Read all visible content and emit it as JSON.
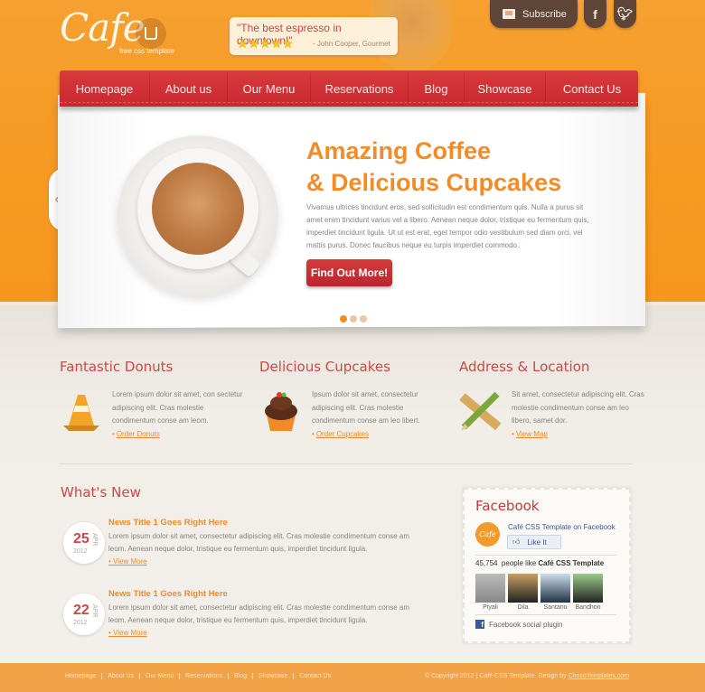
{
  "header": {
    "logo_text": "Cafe",
    "logo_tagline": "free css template",
    "quote": "\"The best espresso in downtown!\"",
    "rating_stars": 5,
    "stars_display": "★★★★★",
    "quote_author": "- John Cooper, Gourmet",
    "subscribe_label": "Subscribe",
    "facebook_label": "f",
    "twitter_label": "t"
  },
  "nav": {
    "items": [
      {
        "label": "Homepage"
      },
      {
        "label": "About us"
      },
      {
        "label": "Our Menu"
      },
      {
        "label": "Reservations"
      },
      {
        "label": "Blog"
      },
      {
        "label": "Showcase"
      },
      {
        "label": "Contact Us"
      }
    ]
  },
  "slider": {
    "title_line1": "Amazing Coffee",
    "title_line2": "& Delicious Cupcakes",
    "text": "Vivamus ultrices tincidunt eros, sed sollicitudin est condimentum quis. Nulla a purus sit amet enim tincidunt varius vel a libero. Aenean neque dolor, tristique eu fermentum quis, imperdiet tincidunt ligula. Ut ut est erat, eget tempor odio vestibulum sed diam orci, vel mattis purus. Donec faucibus neque eu turpis imperdiet commodo.",
    "cta_label": "Find Out More!",
    "prev_icon": "‹",
    "next_icon": "›",
    "slide_count": 3,
    "active_slide": 1
  },
  "features": [
    {
      "title": "Fantastic Donuts",
      "text": "Lorem ipsum dolor sit amet, con sectetur adipiscing elit. Cras molestie condimentum conse am leom.",
      "link": "Order Donuts",
      "icon": "traffic-cone-icon"
    },
    {
      "title": "Delicious Cupcakes",
      "text": "Ipsum dolor sit amet, consectetur adipiscing elit. Cras molestie condimentum conse am leo libert.",
      "link": "Order Cupcakes",
      "icon": "cupcake-icon"
    },
    {
      "title": "Address & Location",
      "text": "Sit amet, consectetur adipiscing elit. Cras molestie condimentum conse am leo libero, samet dor.",
      "link": "View Map",
      "icon": "ruler-pencil-icon"
    }
  ],
  "whats_new": {
    "title": "What's New",
    "items": [
      {
        "day": "25",
        "month": "APR",
        "year": "2012",
        "title": "News Title 1 Goes Right Here",
        "text": "Lorem ipsum dolor sit amet, consectetur adipiscing elit. Cras molestie condimentum conse am leom. Aenean neque dolor, tristique eu fermentum quis, imperdiet tincidunt ligula.",
        "link": "• View More"
      },
      {
        "day": "22",
        "month": "APR",
        "year": "2012",
        "title": "News Title 1 Goes Right Here",
        "text": "Lorem ipsum dolor sit amet, consectetur adipiscing elit. Cras molestie condimentum conse am leom. Aenean neque dolor, tristique eu fermentum quis, imperdiet tincidunt ligula.",
        "link": "• View More"
      }
    ]
  },
  "facebook": {
    "title": "Facebook",
    "logo_text": "Cafe",
    "page_link": "Café CSS Template on Facebook",
    "like_label": "Like It",
    "like_count": "45,754",
    "people_like": "people like",
    "page_name": "Café CSS Template",
    "fans": [
      {
        "name": "Piyali"
      },
      {
        "name": "Dila"
      },
      {
        "name": "Santanu"
      },
      {
        "name": "Bandhon"
      }
    ],
    "plugin_label": "Facebook social plugin"
  },
  "footer": {
    "links": [
      "Homepage",
      "About Us",
      "Our Menu",
      "Reservations",
      "Blog",
      "Showcase",
      "Contact Us"
    ],
    "copyright": "© Copyright 2012  |  Café CSS Template. Design by",
    "designer": "ChocoTemplates.com"
  },
  "colors": {
    "orange": "#f79a22",
    "nav_red": "#d03038",
    "heading_red": "#c84a44",
    "accent_orange": "#f28c2b",
    "brown": "#5e4538"
  }
}
